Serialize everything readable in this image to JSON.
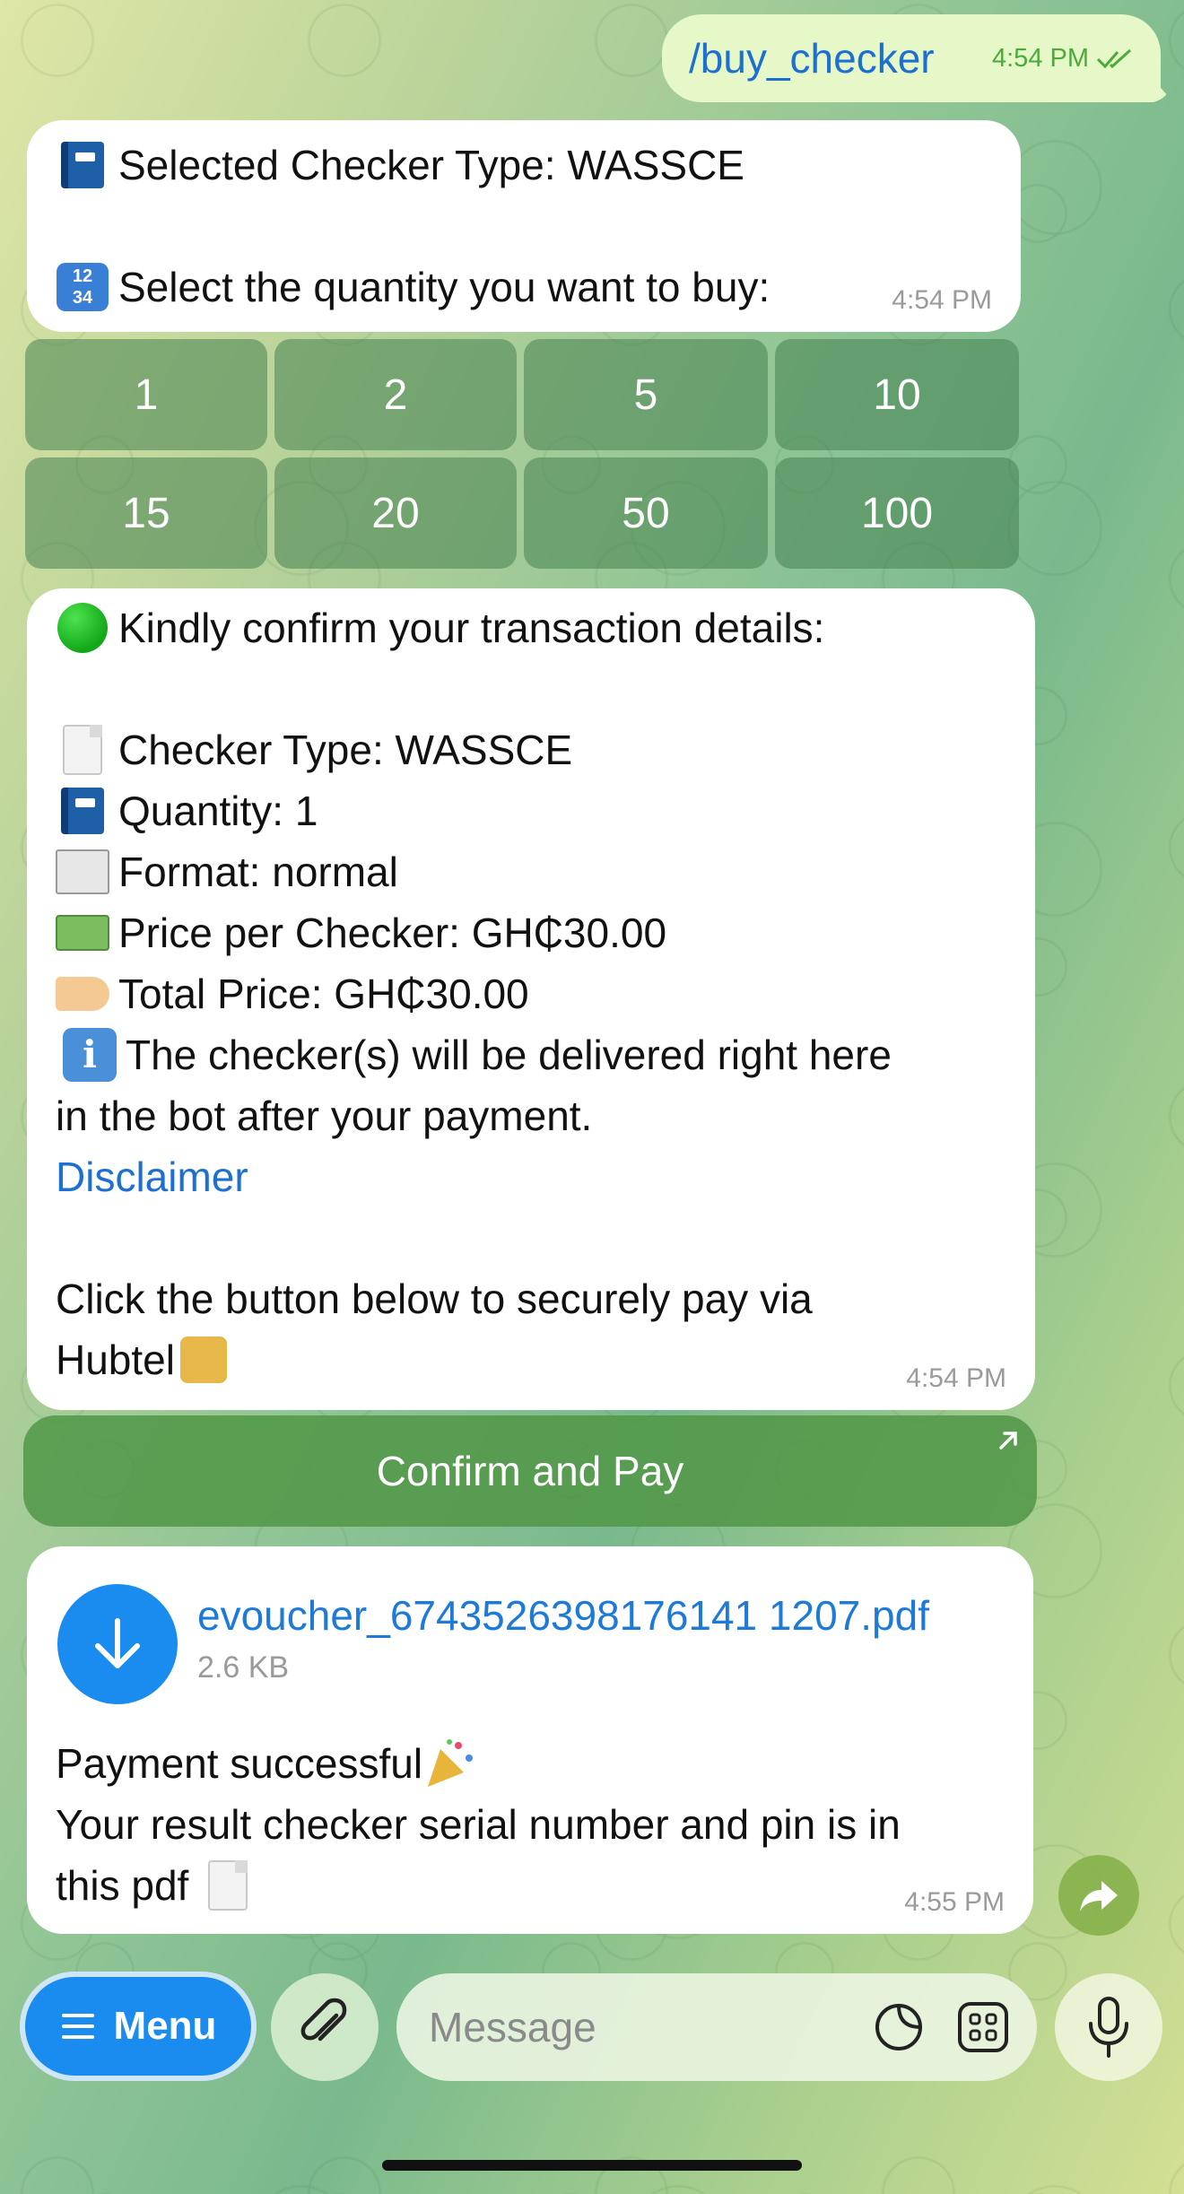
{
  "outgoing": {
    "text": "/buy_checker",
    "time": "4:54 PM"
  },
  "msg1": {
    "line1": "Selected Checker Type: WASSCE",
    "line2": "Select the quantity you want to buy:",
    "numpad_emoji_top": "12",
    "numpad_emoji_bottom": "34",
    "time": "4:54 PM"
  },
  "keyboard": {
    "buttons": [
      "1",
      "2",
      "5",
      "10",
      "15",
      "20",
      "50",
      "100"
    ]
  },
  "msg2": {
    "header": "Kindly confirm your transaction details:",
    "checker_type": "Checker Type: WASSCE",
    "quantity": "Quantity: 1",
    "format": "Format: normal",
    "price_per": "Price per Checker: GH₵30.00",
    "total": "Total Price: GH₵30.00",
    "info_line1": "The checker(s) will be delivered right here",
    "info_line2": "in the bot after your payment.",
    "disclaimer": "Disclaimer",
    "click_line1": "Click the button below to securely pay via",
    "click_line2": "Hubtel",
    "info_glyph": "i",
    "time": "4:54 PM"
  },
  "pay_button": {
    "label": "Confirm and Pay"
  },
  "msg3": {
    "file_name": "evoucher_6743526398176141 1207.pdf",
    "file_size": "2.6 KB",
    "line1": "Payment successful",
    "line2": "Your result checker serial number and pin is in",
    "line3": "this pdf",
    "time": "4:55 PM"
  },
  "bottom_bar": {
    "menu_label": "Menu",
    "message_placeholder": "Message"
  },
  "colors": {
    "accent": "#1a8cf0",
    "link": "#1d6fd1",
    "outgoing_bubble": "#e6f8c8",
    "time_green": "#4caa3b"
  }
}
